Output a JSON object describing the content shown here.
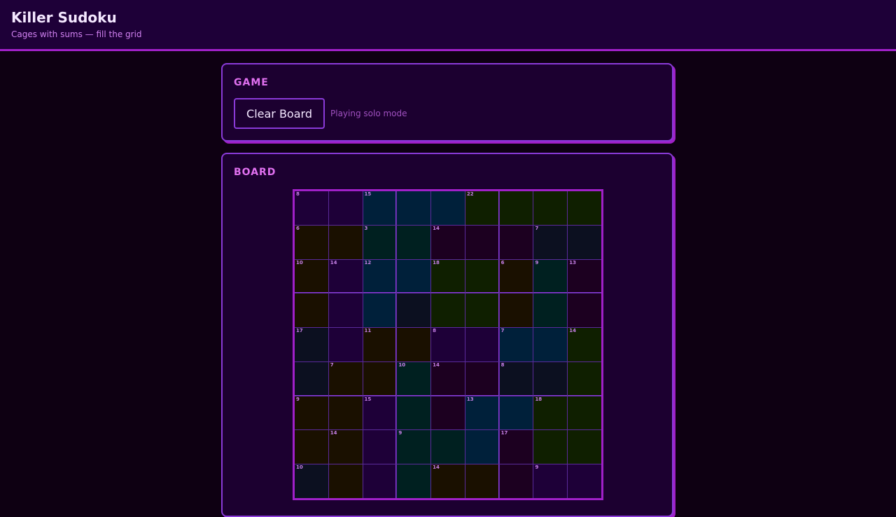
{
  "header": {
    "title": "Killer Sudoku",
    "subtitle": "Cages with sums — fill the grid"
  },
  "game_panel": {
    "heading": "GAME",
    "clear_button_label": "Clear Board",
    "mode_text": "Playing solo mode"
  },
  "board_panel": {
    "heading": "BOARD"
  },
  "colors": {
    "accent": "#a020c8",
    "border": "#8a3ad8",
    "panel_bg": "#1c0030",
    "page_bg": "#0e0012"
  },
  "board": {
    "cage_sums": [
      [
        "8",
        "",
        "15",
        "",
        "",
        "22",
        "",
        "",
        ""
      ],
      [
        "6",
        "",
        "3",
        "",
        "14",
        "",
        "",
        "7",
        ""
      ],
      [
        "10",
        "14",
        "12",
        "",
        "18",
        "",
        "6",
        "9",
        "13"
      ],
      [
        "",
        "",
        "",
        "",
        "",
        "",
        "",
        "",
        ""
      ],
      [
        "17",
        "",
        "11",
        "",
        "8",
        "",
        "7",
        "",
        "14"
      ],
      [
        "",
        "7",
        "",
        "10",
        "14",
        "",
        "8",
        "",
        ""
      ],
      [
        "9",
        "",
        "15",
        "",
        "",
        "13",
        "",
        "18",
        ""
      ],
      [
        "",
        "14",
        "",
        "9",
        "",
        "",
        "17",
        "",
        ""
      ],
      [
        "10",
        "",
        "",
        "",
        "14",
        "",
        "",
        "9",
        ""
      ]
    ],
    "cell_colors": [
      [
        "#1e0038",
        "#1e0038",
        "#00203a",
        "#00203a",
        "#00203a",
        "#0f1f00",
        "#0f1f00",
        "#0f1f00",
        "#0f1f00"
      ],
      [
        "#1a1000",
        "#1a1000",
        "#002020",
        "#002020",
        "#1c0020",
        "#1c0020",
        "#1c0020",
        "#0c1020",
        "#0c1020"
      ],
      [
        "#1a1000",
        "#1e0038",
        "#00203a",
        "#00203a",
        "#0f1f00",
        "#0f1f00",
        "#1a1000",
        "#002020",
        "#1c0020"
      ],
      [
        "#1a1000",
        "#1e0038",
        "#00203a",
        "#0c1020",
        "#0f1f00",
        "#0f1f00",
        "#1a1000",
        "#002020",
        "#1c0020"
      ],
      [
        "#0c1020",
        "#1e0038",
        "#1a1000",
        "#1a1000",
        "#1e0038",
        "#1e0038",
        "#00203a",
        "#00203a",
        "#0f1f00"
      ],
      [
        "#0c1020",
        "#1a1000",
        "#1a1000",
        "#002020",
        "#1c0020",
        "#1c0020",
        "#0c1020",
        "#0c1020",
        "#0f1f00"
      ],
      [
        "#1a1000",
        "#1a1000",
        "#1e0038",
        "#002020",
        "#1c0020",
        "#00203a",
        "#00203a",
        "#0f1f00",
        "#0f1f00"
      ],
      [
        "#1a1000",
        "#1a1000",
        "#1e0038",
        "#002020",
        "#002020",
        "#00203a",
        "#1c0020",
        "#0f1f00",
        "#0f1f00"
      ],
      [
        "#0c1020",
        "#1a1000",
        "#1e0038",
        "#002020",
        "#1a1000",
        "#1a1000",
        "#1c0020",
        "#1e0038",
        "#1e0038"
      ]
    ]
  }
}
